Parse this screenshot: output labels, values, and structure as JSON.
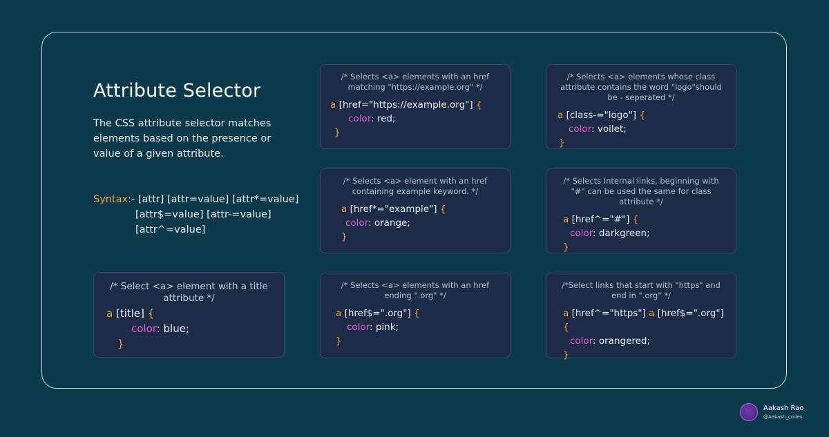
{
  "title": "Attribute Selector",
  "description": "The CSS attribute selector matches elements based on the presence or value of a given attribute.",
  "syntax": {
    "label": "Syntax",
    "sep": ":- ",
    "line1": "[attr] [attr=value] [attr*=value]",
    "line2": "[attr$=value] [attr-=value]",
    "line3": "[attr^=value]"
  },
  "cards": [
    {
      "comment": "/* Selects <a> elements with an href matching \"https://example.org\" */",
      "tag": "a",
      "selector": "[href=\"https://example.org\"]",
      "brace_open": "{",
      "prop": "color",
      "value": ": red;",
      "brace_close": "}"
    },
    {
      "comment": "/* Selects <a> elements whose class attribute contains the word \"logo\"should be - seperated */",
      "tag": "a",
      "selector": "[class-=\"logo\"]",
      "brace_open": "{",
      "prop": "color",
      "value": ": voilet;",
      "brace_close": "}"
    },
    {
      "comment": "/* Selects <a> element with an href containing example keyword. */",
      "tag": "a",
      "selector": "[href*=\"example\"]",
      "brace_open": "{",
      "prop": "color",
      "value": ": orange;",
      "brace_close": "}"
    },
    {
      "comment": "/* Selects Internal links, beginning with \"#\" can be used the same for class attribute */",
      "tag": "a",
      "selector": "[href^=\"#\"]",
      "brace_open": "{",
      "prop": "color",
      "value": ": darkgreen;",
      "brace_close": "}"
    },
    {
      "comment": "/* Selects <a> elements with an href ending \".org\" */",
      "tag": "a",
      "selector": "[href$=\".org\"]",
      "brace_open": "{",
      "prop": "color",
      "value": ": pink;",
      "brace_close": "}"
    },
    {
      "comment": "/*Select links that start with \"https\" and end in \".org\" */",
      "tag": "a",
      "selector": "[href^=\"https\"]",
      "tag2": "a",
      "selector2": "[href$=\".org\"]",
      "brace_open": "{",
      "prop": "color",
      "value": ": orangered;",
      "brace_close": "}"
    },
    {
      "comment": "/* Select <a> element with a title attribute */",
      "tag": "a",
      "selector": "[title]",
      "brace_open": "{",
      "prop": "color",
      "value": ": blue;",
      "brace_close": "}"
    }
  ],
  "author": {
    "name": "Aakash Rao",
    "handle": "@Aakash_codes"
  },
  "colors": {
    "background": "#0c3a4b",
    "card": "#1d2b47",
    "keyword": "#f0a441",
    "property": "#e45bd6"
  }
}
